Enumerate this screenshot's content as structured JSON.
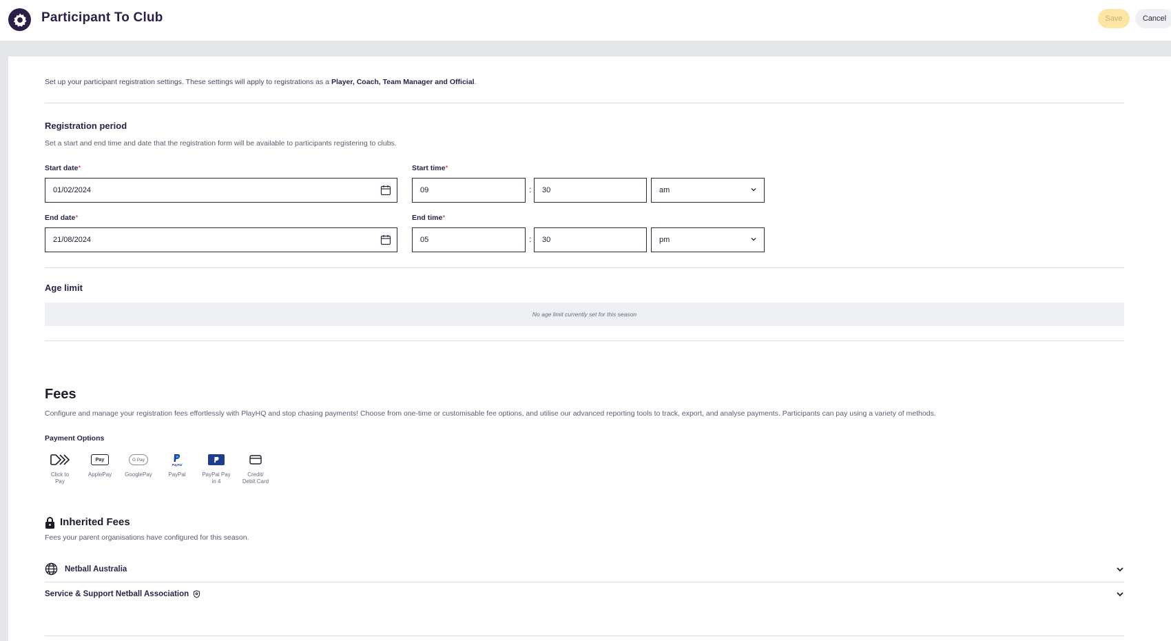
{
  "header": {
    "title": "Participant To Club",
    "save_label": "Save",
    "cancel_label": "Cancel"
  },
  "intro": {
    "text_before": "Set up your participant registration settings. These settings will apply to registrations as a ",
    "roles": "Player, Coach, Team Manager and Official",
    "text_after": "."
  },
  "registration_period": {
    "title": "Registration period",
    "description": "Set a start and end time and date that the registration form will be available to participants registering to clubs.",
    "start_date_label": "Start date",
    "start_date_value": "01/02/2024",
    "start_time_label": "Start time",
    "start_hour": "09",
    "start_minute": "30",
    "start_meridiem": "am",
    "end_date_label": "End date",
    "end_date_value": "21/08/2024",
    "end_time_label": "End time",
    "end_hour": "05",
    "end_minute": "30",
    "end_meridiem": "pm",
    "required_marker": "*",
    "colon": ":"
  },
  "age_limit": {
    "title": "Age limit",
    "empty_text": "No age limit currently set for this season"
  },
  "fees": {
    "title": "Fees",
    "description": "Configure and manage your registration fees effortlessly with PlayHQ and stop chasing payments! Choose from one-time or customisable fee options, and utilise our advanced reporting tools to track, export, and analyse payments. Participants can pay using a variety of methods.",
    "payment_options_label": "Payment Options",
    "payment_options": [
      {
        "label_line1": "Click to",
        "label_line2": "Pay",
        "icon": "click-to-pay-icon"
      },
      {
        "label_line1": "ApplePay",
        "label_line2": "",
        "icon": "applepay-icon"
      },
      {
        "label_line1": "GooglePay",
        "label_line2": "",
        "icon": "googlepay-icon"
      },
      {
        "label_line1": "PayPal",
        "label_line2": "",
        "icon": "paypal-icon"
      },
      {
        "label_line1": "PayPal Pay",
        "label_line2": "in 4",
        "icon": "paypal-pay-in-4-icon"
      },
      {
        "label_line1": "Credit/",
        "label_line2": "Debit Card",
        "icon": "credit-card-icon"
      }
    ],
    "applepay_badge": "Pay",
    "googlepay_badge": "G Pay",
    "paypal_badge": "PayPal"
  },
  "inherited_fees": {
    "title": "Inherited Fees",
    "description": "Fees your parent organisations have configured for this season.",
    "organisations": [
      {
        "name": "Netball Australia",
        "icon": "globe-icon"
      },
      {
        "name": "Service & Support Netball Association",
        "icon": "shield-icon"
      }
    ]
  },
  "colors": {
    "brand_dark": "#2b1f48",
    "save_disabled_bg": "#fbe6a6",
    "paypal_blue": "#1f3c8f"
  }
}
